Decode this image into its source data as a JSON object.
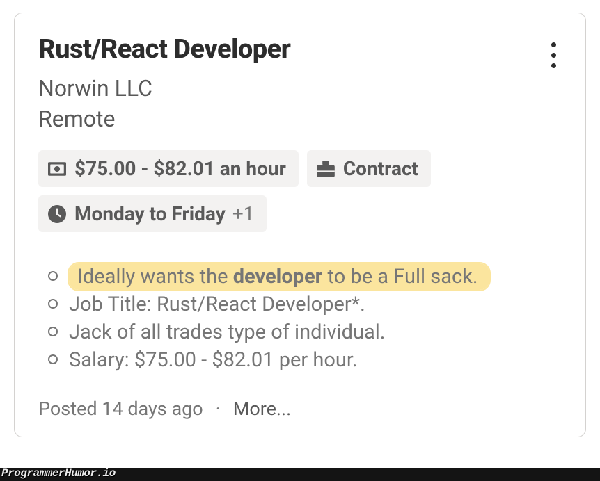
{
  "job": {
    "title": "Rust/React Developer",
    "company": "Norwin LLC",
    "location": "Remote"
  },
  "chips": {
    "pay": "$75.00 - $82.01 an hour",
    "type": "Contract",
    "schedule": "Monday to Friday",
    "schedule_extra": "+1"
  },
  "bullets": {
    "b0_pre": "Ideally wants the ",
    "b0_bold": "developer",
    "b0_post": " to be a Full sack.",
    "b1": "Job Title: Rust/React Developer*.",
    "b2": "Jack of all trades type of individual.",
    "b3": "Salary: $75.00 - $82.01 per hour."
  },
  "footer": {
    "posted": "Posted 14 days ago",
    "more": "More..."
  },
  "watermark": "ProgrammerHumor.io"
}
